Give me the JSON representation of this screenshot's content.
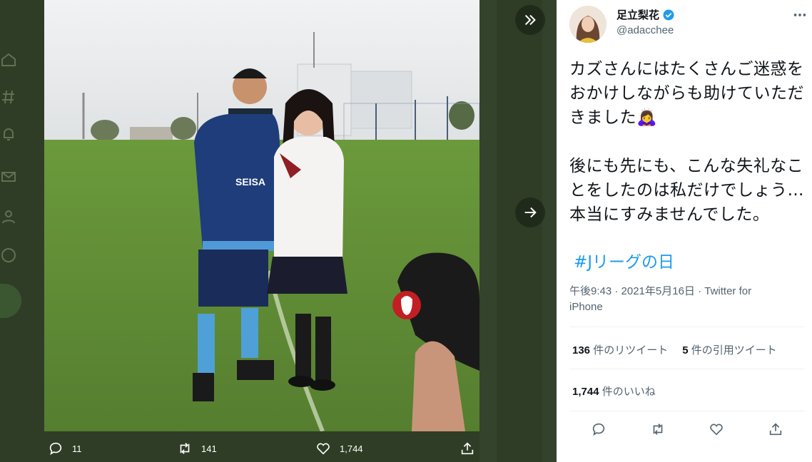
{
  "author": {
    "display_name": "足立梨花",
    "handle": "@adacchee",
    "verified": true
  },
  "tweet": {
    "text_para1": "カズさんにはたくさんご迷惑をおかけしながらも助けていただきました🙇‍♀️",
    "text_para2": "後にも先にも、こんな失礼なことをしたのは私だけでしょう…",
    "text_para3": "本当にすみませんでした。",
    "hashtag": "#Jリーグの日",
    "timestamp": "午後9:43 · 2021年5月16日 · Twitter for iPhone"
  },
  "stats": {
    "retweets_count": "136",
    "retweets_label": "件のリツイート",
    "quotes_count": "5",
    "quotes_label": "件の引用ツイート",
    "likes_count": "1,744",
    "likes_label": "件のいいね"
  },
  "photo_actions": {
    "reply_count": "11",
    "retweet_count": "141",
    "like_count": "1,744"
  },
  "icons": {
    "collapse": "double-chevron-right-icon",
    "next": "arrow-right-icon",
    "more": "more-dots-icon",
    "verified": "verified-badge-icon",
    "reply": "reply-icon",
    "retweet": "retweet-icon",
    "like": "heart-icon",
    "share": "share-icon"
  },
  "colors": {
    "accent": "#1d9bf0",
    "backdrop": "#2f3d26",
    "secondary_text": "#536471"
  }
}
